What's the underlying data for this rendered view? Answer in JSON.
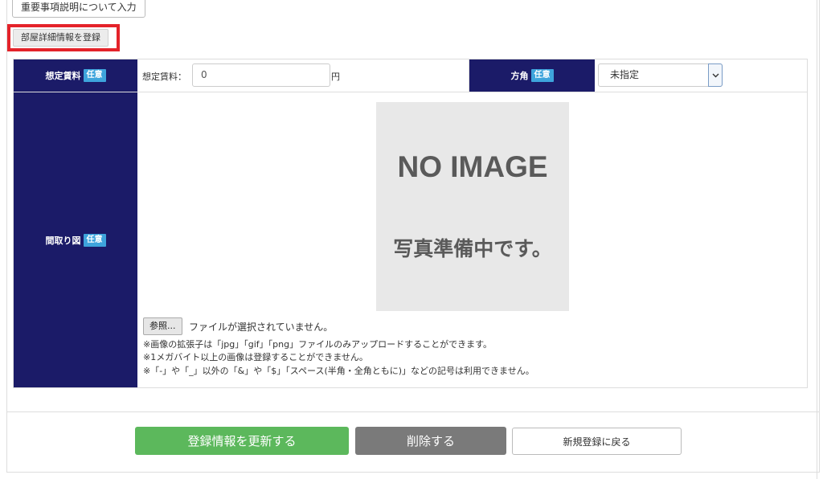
{
  "top_button": {
    "label": "重要事項説明について入力"
  },
  "room_button": {
    "label": "部屋詳細情報を登録"
  },
  "rent_row": {
    "header": "想定賃料",
    "badge": "任意",
    "field_label": "想定賃料：",
    "value": "0",
    "unit": "円"
  },
  "direction": {
    "header": "方角",
    "badge": "任意",
    "selected": "未指定"
  },
  "floor_plan": {
    "header": "間取り図",
    "badge": "任意",
    "placeholder_title": "NO IMAGE",
    "placeholder_sub": "写真準備中です。",
    "file_button": "参照...",
    "file_status": "ファイルが選択されていません。",
    "notes": [
      "※画像の拡張子は「jpg」「gif」「png」ファイルのみアップロードすることができます。",
      "※1メガバイト以上の画像は登録することができません。",
      "※「-」や「_」以外の「&」や「$」「スペース(半角・全角ともに)」などの記号は利用できません。"
    ]
  },
  "footer": {
    "update_label": "登録情報を更新する",
    "delete_label": "削除する",
    "back_label": "新規登録に戻る"
  },
  "colors": {
    "header_bg": "#1b1b68",
    "badge_bg": "#3ea4dc",
    "update_bg": "#5cb85c",
    "delete_bg": "#7a7a7a",
    "highlight": "#e4232a"
  },
  "icons": {
    "select_arrow": "chevron-down-icon"
  }
}
